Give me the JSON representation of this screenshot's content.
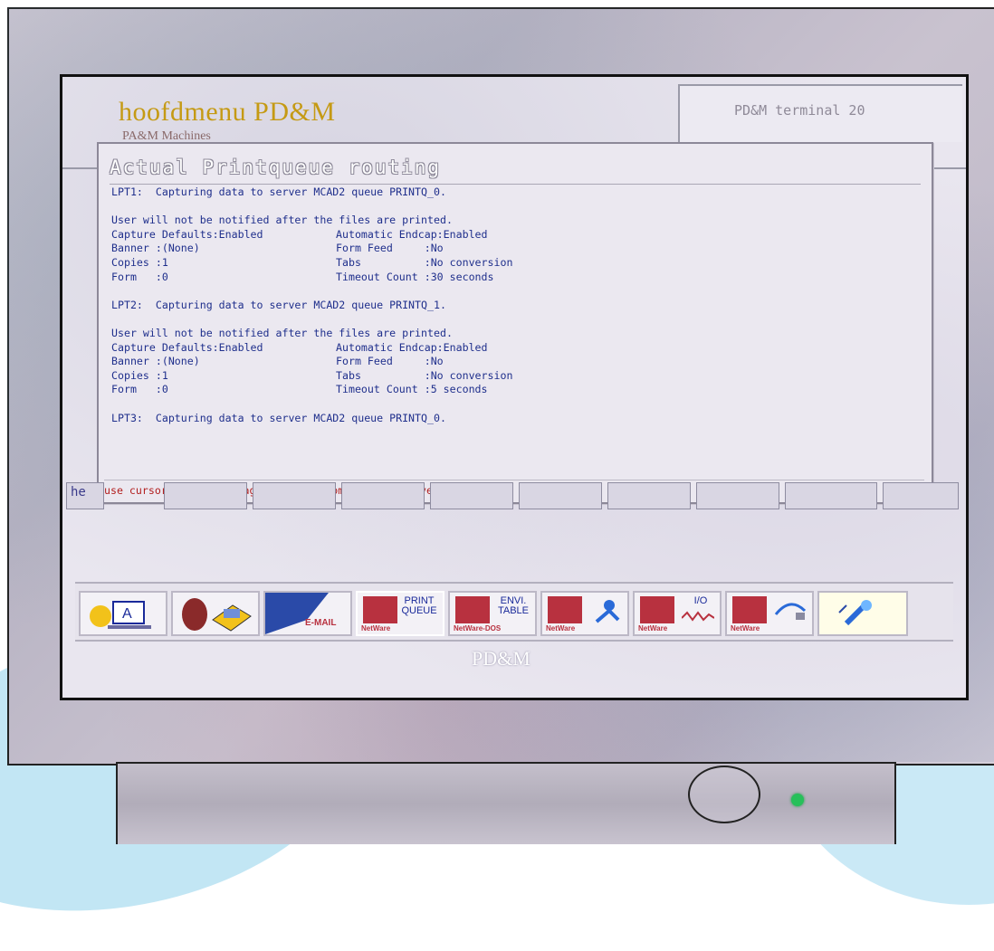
{
  "app": {
    "title": "hoofdmenu PD&M",
    "subtitle": "PA&M Machines",
    "terminal": "PD&M terminal  20"
  },
  "dialog": {
    "title": "Actual Printqueue routing",
    "lines": [
      "LPT1:  Capturing data to server MCAD2 queue PRINTQ_0.",
      "",
      "User will not be notified after the files are printed."
    ],
    "lpt1": {
      "header": "LPT1:  Capturing data to server MCAD2 queue PRINTQ_0.",
      "notify": "User will not be notified after the files are printed.",
      "rows": [
        [
          "Capture Defaults:Enabled",
          "Automatic Endcap:Enabled"
        ],
        [
          "Banner :(None)",
          "Form Feed     :No"
        ],
        [
          "Copies :1",
          "Tabs          :No conversion"
        ],
        [
          "Form   :0",
          "Timeout Count :30 seconds"
        ]
      ]
    },
    "lpt2": {
      "header": "LPT2:  Capturing data to server MCAD2 queue PRINTQ_1.",
      "notify": "User will not be notified after the files are printed.",
      "rows": [
        [
          "Capture Defaults:Enabled",
          "Automatic Endcap:Enabled"
        ],
        [
          "Banner :(None)",
          "Form Feed     :No"
        ],
        [
          "Copies :1",
          "Tabs          :No conversion"
        ],
        [
          "Form   :0",
          "Timeout Count :5 seconds"
        ]
      ]
    },
    "lpt3": {
      "header": "LPT3:  Capturing data to server MCAD2 queue PRINTQ_0."
    },
    "hint": "use cursor(up/down), Page Up/Down ^Home ^End to move text"
  },
  "midbar": {
    "help_label": "he"
  },
  "icons": [
    {
      "name": "desktop-icon",
      "label": ""
    },
    {
      "name": "files-icon",
      "label": ""
    },
    {
      "name": "email-icon",
      "label": "E-MAIL"
    },
    {
      "name": "print-queue-icon",
      "label": "PRINT QUEUE",
      "brand": "NetWare"
    },
    {
      "name": "envi-table-icon",
      "label": "ENVI. TABLE",
      "brand": "NetWare-DOS"
    },
    {
      "name": "netware-user-icon",
      "label": "",
      "brand": "NetWare"
    },
    {
      "name": "netware-io-icon",
      "label": "I/O",
      "brand": "NetWare"
    },
    {
      "name": "netware-connect-icon",
      "label": "",
      "brand": "NetWare"
    },
    {
      "name": "tools-icon",
      "label": ""
    }
  ],
  "footer": {
    "logo": "PD&M"
  },
  "colors": {
    "title_gold": "#c59a14",
    "text_blue": "#1f2f8c",
    "hint_red": "#b21e1e",
    "netware_red": "#b8313f",
    "led_green": "#27c05a"
  }
}
